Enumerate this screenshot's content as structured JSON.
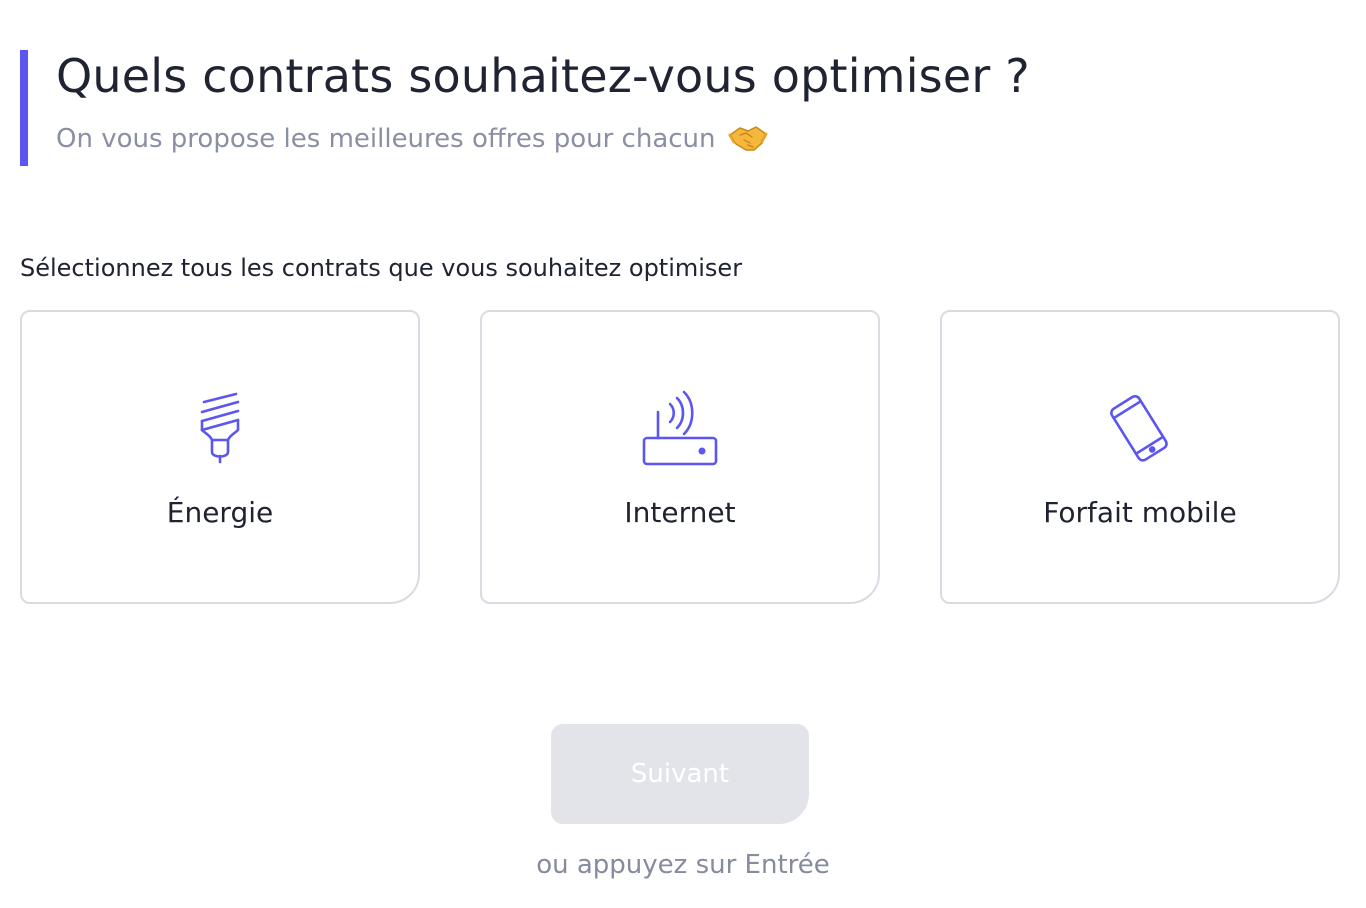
{
  "header": {
    "title": "Quels contrats souhaitez-vous optimiser ?",
    "subtitle": "On vous propose les meilleures offres pour chacun",
    "subtitle_emoji": "handshake-icon"
  },
  "instruction": "Sélectionnez tous les contrats que vous souhaitez optimiser",
  "cards": [
    {
      "label": "Énergie",
      "icon": "light-bulb-icon"
    },
    {
      "label": "Internet",
      "icon": "router-icon"
    },
    {
      "label": "Forfait mobile",
      "icon": "mobile-phone-icon"
    }
  ],
  "actions": {
    "next_label": "Suivant",
    "next_enabled": false,
    "hint": "ou appuyez sur Entrée"
  },
  "colors": {
    "accent": "#5b56f0",
    "text": "#202332",
    "muted": "#8a8fa3",
    "card_border": "#d9dbe3",
    "button_disabled_bg": "#e3e4ea"
  }
}
